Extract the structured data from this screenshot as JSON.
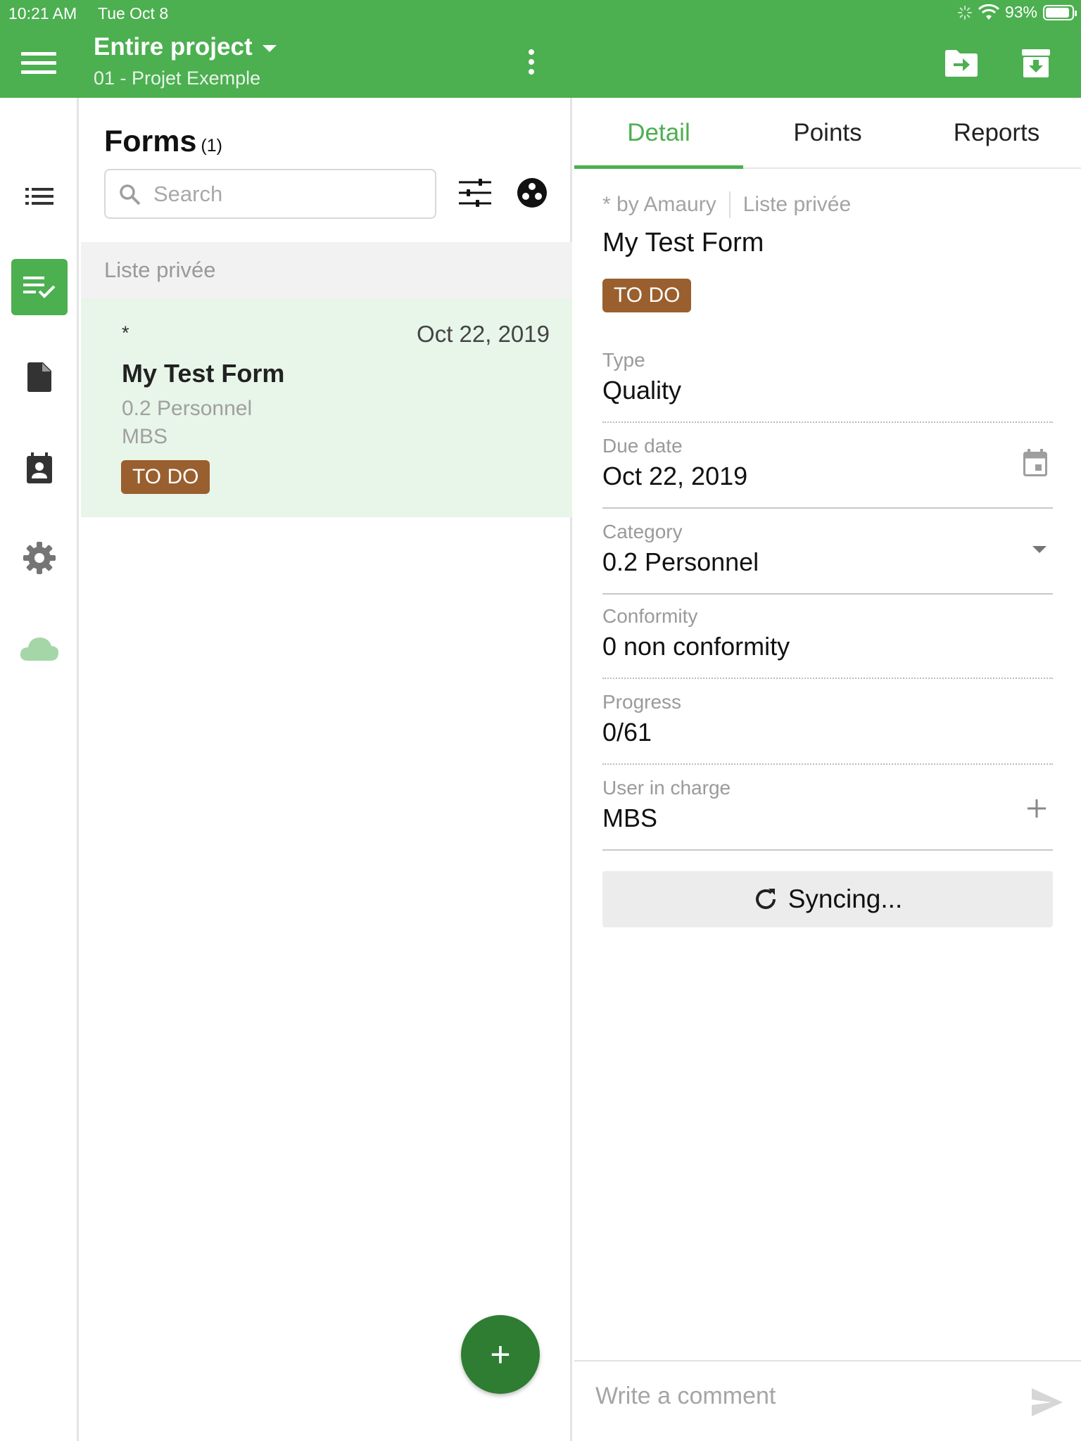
{
  "status_bar": {
    "time": "10:21 AM",
    "date": "Tue Oct 8",
    "battery": "93%",
    "battery_level": 0.93
  },
  "app_bar": {
    "title": "Entire project",
    "subtitle": "01 - Projet Exemple",
    "icons": [
      "menu-icon",
      "more-vert-icon",
      "folder-export-icon",
      "archive-download-icon"
    ]
  },
  "rail": {
    "items": [
      {
        "icon": "list-icon"
      },
      {
        "icon": "checklist-icon",
        "active": true
      },
      {
        "icon": "document-icon"
      },
      {
        "icon": "contact-calendar-icon"
      },
      {
        "icon": "settings-gear-icon"
      },
      {
        "icon": "cloud-icon"
      }
    ]
  },
  "forms_panel": {
    "title": "Forms",
    "count": "(1)",
    "search_placeholder": "Search",
    "section": "Liste privée",
    "card": {
      "star": "*",
      "date": "Oct 22, 2019",
      "title": "My Test Form",
      "category": "0.2 Personnel",
      "user": "MBS",
      "status": "TO DO"
    },
    "fab_label": "+"
  },
  "detail": {
    "tabs": [
      {
        "label": "Detail",
        "active": true
      },
      {
        "label": "Points"
      },
      {
        "label": "Reports"
      }
    ],
    "meta_author": "* by Amaury",
    "meta_list": "Liste privée",
    "title": "My Test Form",
    "status": "TO DO",
    "fields": {
      "type": {
        "label": "Type",
        "value": "Quality"
      },
      "due_date": {
        "label": "Due date",
        "value": "Oct 22, 2019"
      },
      "category": {
        "label": "Category",
        "value": "0.2 Personnel"
      },
      "conformity": {
        "label": "Conformity",
        "value": "0 non conformity"
      },
      "progress": {
        "label": "Progress",
        "value": "0/61"
      },
      "user": {
        "label": "User in charge",
        "value": "MBS"
      }
    },
    "sync_label": "Syncing...",
    "comment_placeholder": "Write a comment"
  },
  "colors": {
    "primary": "#4caf50",
    "primary_dark": "#2e7d32",
    "selected_row": "#e8f5e9",
    "badge": "#9a5f2e",
    "cloud": "#a5d6a7"
  }
}
